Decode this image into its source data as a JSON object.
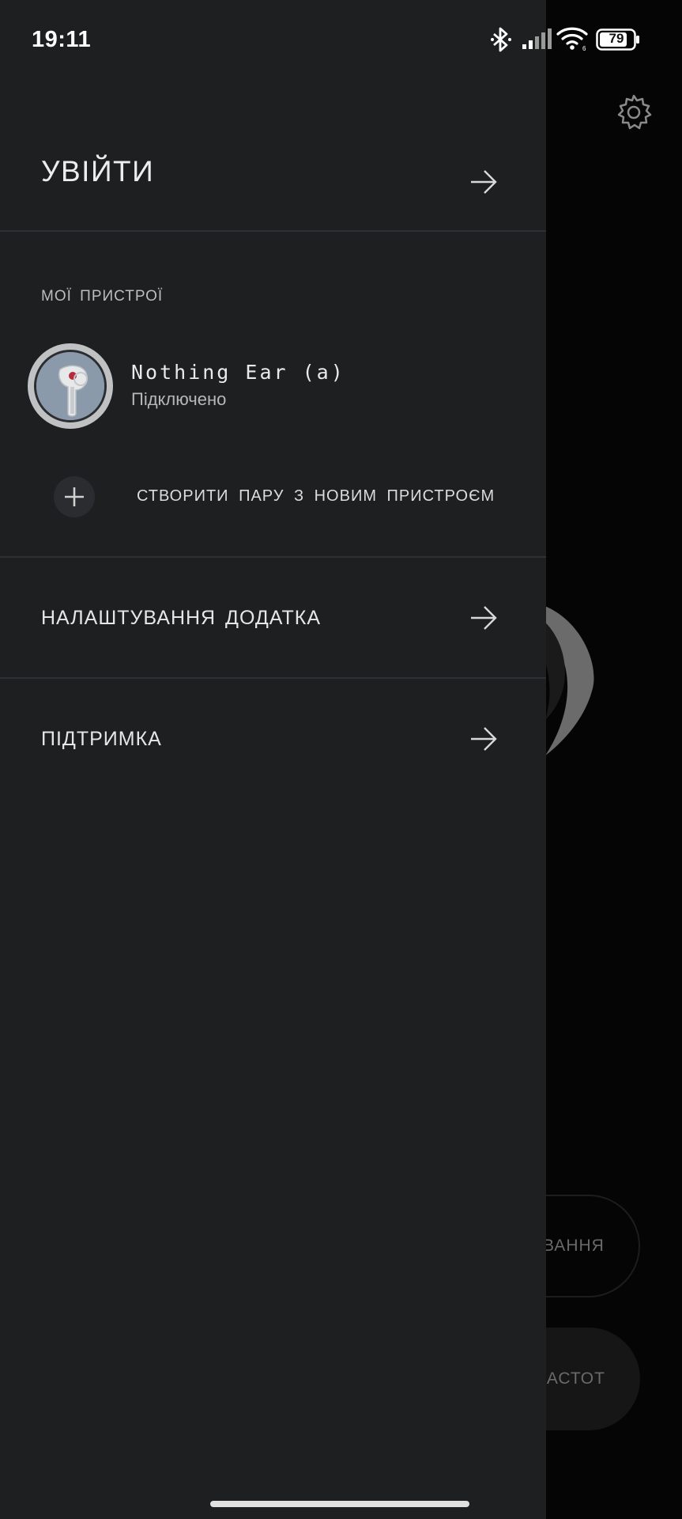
{
  "status_bar": {
    "time": "19:11",
    "battery_level": "79"
  },
  "background_app": {
    "pill_outline_label": "ВАННЯ",
    "pill_filled_label": "Х ЧАСТОТ"
  },
  "drawer": {
    "login_label": "УВІЙТИ",
    "devices_section_title": "МОЇ ПРИСТРОЇ",
    "devices": [
      {
        "name": "Nothing Ear (a)",
        "status": "Підключено"
      }
    ],
    "pair_new_label": "СТВОРИТИ ПАРУ З НОВИМ ПРИСТРОЄМ",
    "menu": [
      {
        "label": "НАЛАШТУВАННЯ ДОДАТКА"
      },
      {
        "label": "ПІДТРИМКА"
      }
    ]
  },
  "colors": {
    "drawer_bg": "#1e1f21",
    "background": "#050505",
    "text": "#e8e8e8",
    "divider": "#2f3033"
  }
}
